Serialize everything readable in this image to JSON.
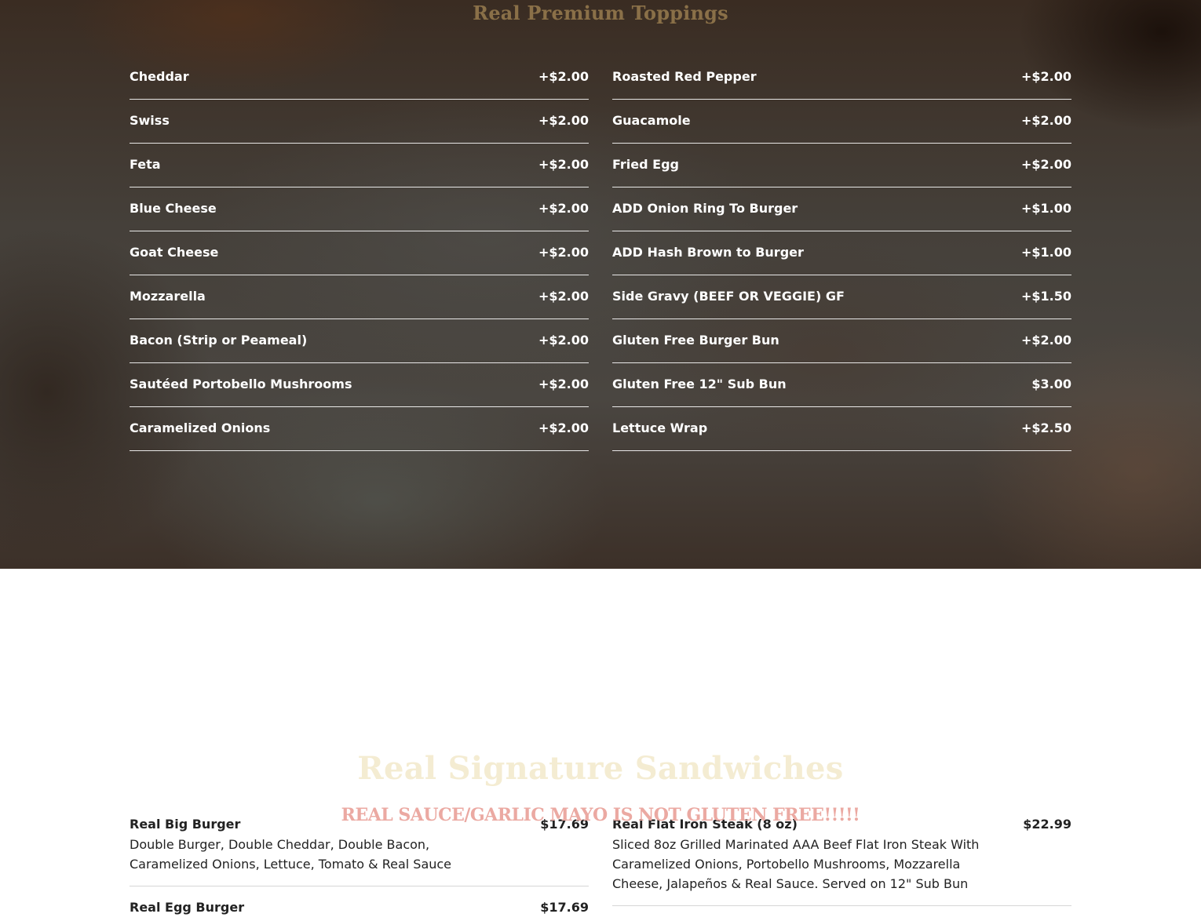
{
  "toppings": {
    "title": "Real Premium Toppings",
    "left": [
      {
        "name": "Cheddar",
        "price": "+$2.00"
      },
      {
        "name": "Swiss",
        "price": "+$2.00"
      },
      {
        "name": "Feta",
        "price": "+$2.00"
      },
      {
        "name": "Blue Cheese",
        "price": "+$2.00"
      },
      {
        "name": "Goat Cheese",
        "price": "+$2.00"
      },
      {
        "name": "Mozzarella",
        "price": "+$2.00"
      },
      {
        "name": "Bacon (Strip or Peameal)",
        "price": "+$2.00"
      },
      {
        "name": "Sautéed Portobello Mushrooms",
        "price": "+$2.00"
      },
      {
        "name": "Caramelized Onions",
        "price": "+$2.00"
      }
    ],
    "right": [
      {
        "name": "Roasted Red Pepper",
        "price": "+$2.00"
      },
      {
        "name": "Guacamole",
        "price": "+$2.00"
      },
      {
        "name": "Fried Egg",
        "price": "+$2.00"
      },
      {
        "name": "ADD Onion Ring To Burger",
        "price": "+$1.00"
      },
      {
        "name": "ADD Hash Brown to Burger",
        "price": "+$1.00"
      },
      {
        "name": "Side Gravy (BEEF OR VEGGIE) GF",
        "price": "+$1.50"
      },
      {
        "name": "Gluten Free Burger Bun",
        "price": "+$2.00"
      },
      {
        "name": "Gluten Free 12\" Sub Bun",
        "price": "$3.00"
      },
      {
        "name": "Lettuce Wrap",
        "price": "+$2.50"
      }
    ]
  },
  "sandwiches": {
    "title": "Real Signature Sandwiches",
    "warning": "REAL SAUCE/GARLIC MAYO IS NOT GLUTEN FREE!!!!!",
    "left": [
      {
        "name": "Real Big Burger",
        "price": "$17.69",
        "description": "Double Burger, Double Cheddar, Double Bacon, Caramelized Onions, Lettuce, Tomato & Real Sauce"
      },
      {
        "name": "Real Egg Burger",
        "price": "$17.69",
        "description": ""
      }
    ],
    "right": [
      {
        "name": "Real Flat Iron Steak (8 oz)",
        "price": "$22.99",
        "description": "Sliced 8oz Grilled Marinated AAA Beef Flat Iron Steak With Caramelized Onions, Portobello Mushrooms, Mozzarella Cheese, Jalapeños & Real Sauce. Served on 12\" Sub Bun"
      }
    ]
  },
  "colors": {
    "toppings_title": "#8a7048",
    "sandwiches_title": "#f4ecd2",
    "warning": "#eba9a2",
    "topping_text": "#ffffff",
    "sandwich_text": "#222222"
  }
}
